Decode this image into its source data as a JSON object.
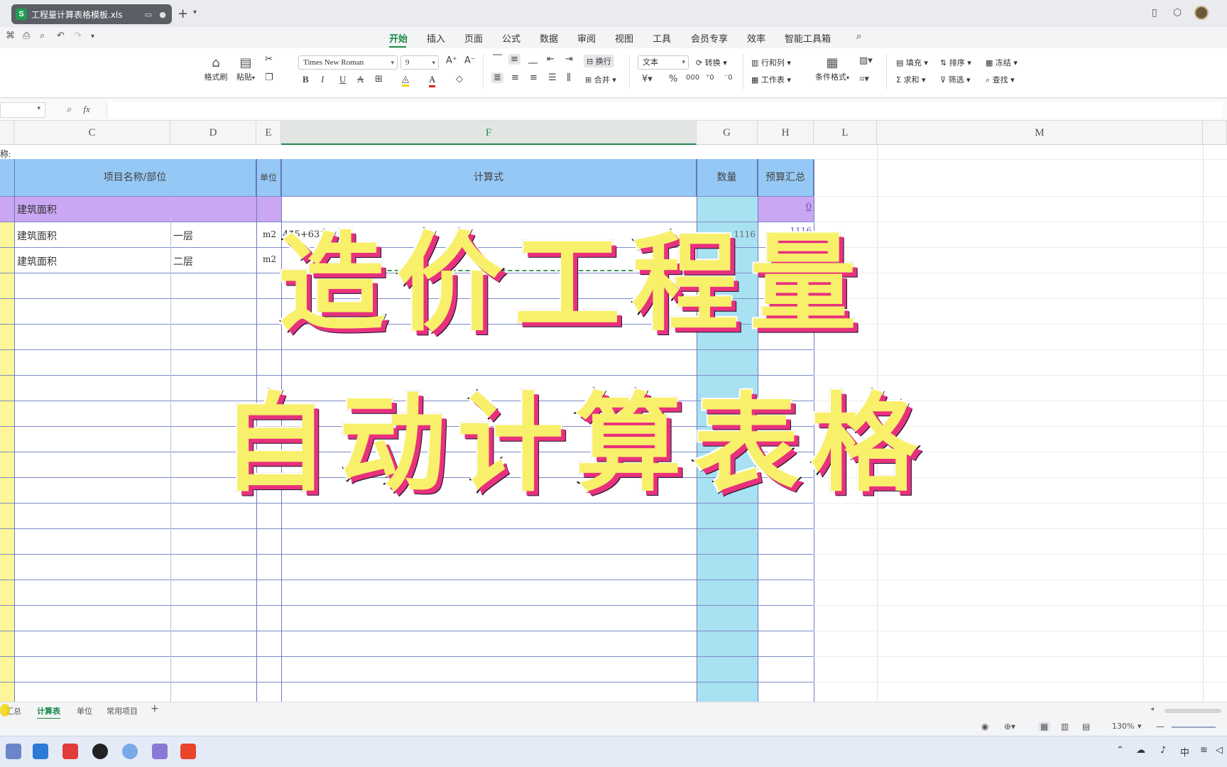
{
  "window": {
    "doc_title": "工程量计算表格模板.xls",
    "app_badge": "S"
  },
  "menu": {
    "items": [
      "开始",
      "插入",
      "页面",
      "公式",
      "数据",
      "审阅",
      "视图",
      "工具",
      "会员专享",
      "效率",
      "智能工具箱"
    ],
    "active": "开始"
  },
  "ribbon": {
    "format_painter": "格式刷",
    "paste": "粘贴",
    "font_name": "Times New Roman",
    "font_size": "9",
    "wrap": "换行",
    "merge": "合并",
    "number_format": "文本",
    "convert": "转换",
    "row_col": "行和列",
    "worksheet": "工作表",
    "cond_format": "条件格式",
    "fill": "填充",
    "sort": "排序",
    "freeze": "冻结",
    "sum": "求和",
    "filter": "筛选",
    "find": "查找"
  },
  "formula_bar": {
    "fx": "fx"
  },
  "sheet": {
    "columns": [
      "C",
      "D",
      "E",
      "F",
      "G",
      "H",
      "L",
      "M"
    ],
    "selected_column": "F",
    "title_fragment": "称:",
    "headers": {
      "name": "项目名称/部位",
      "unit": "单位",
      "formula": "计算式",
      "quantity": "数量",
      "budget": "预算汇总"
    },
    "rows": [
      {
        "name": "建筑面积",
        "part": "",
        "unit": "",
        "formula": "",
        "quantity": "",
        "budget": "0"
      },
      {
        "name": "建筑面积",
        "part": "一层",
        "unit": "m2",
        "formula": "485+631",
        "quantity": "1116",
        "budget": "1116"
      },
      {
        "name": "建筑面积",
        "part": "二层",
        "unit": "m2",
        "formula": "",
        "quantity": "",
        "budget": ""
      }
    ]
  },
  "overlay": {
    "line1": "造价工程量",
    "line2": "自动计算表格"
  },
  "sheet_tabs": {
    "tabs": [
      "汇总",
      "计算表",
      "单位",
      "常用项目"
    ],
    "active": "计算表",
    "add": "+"
  },
  "status": {
    "zoom": "130%"
  },
  "taskbar": {
    "ime": "中"
  },
  "colors": {
    "header_blue": "#95c8f5",
    "section_purple": "#caa7f2",
    "quantity_cyan": "#a8e2f2",
    "left_yellow": "#fdf59a",
    "accent_green": "#1e8a4c"
  }
}
